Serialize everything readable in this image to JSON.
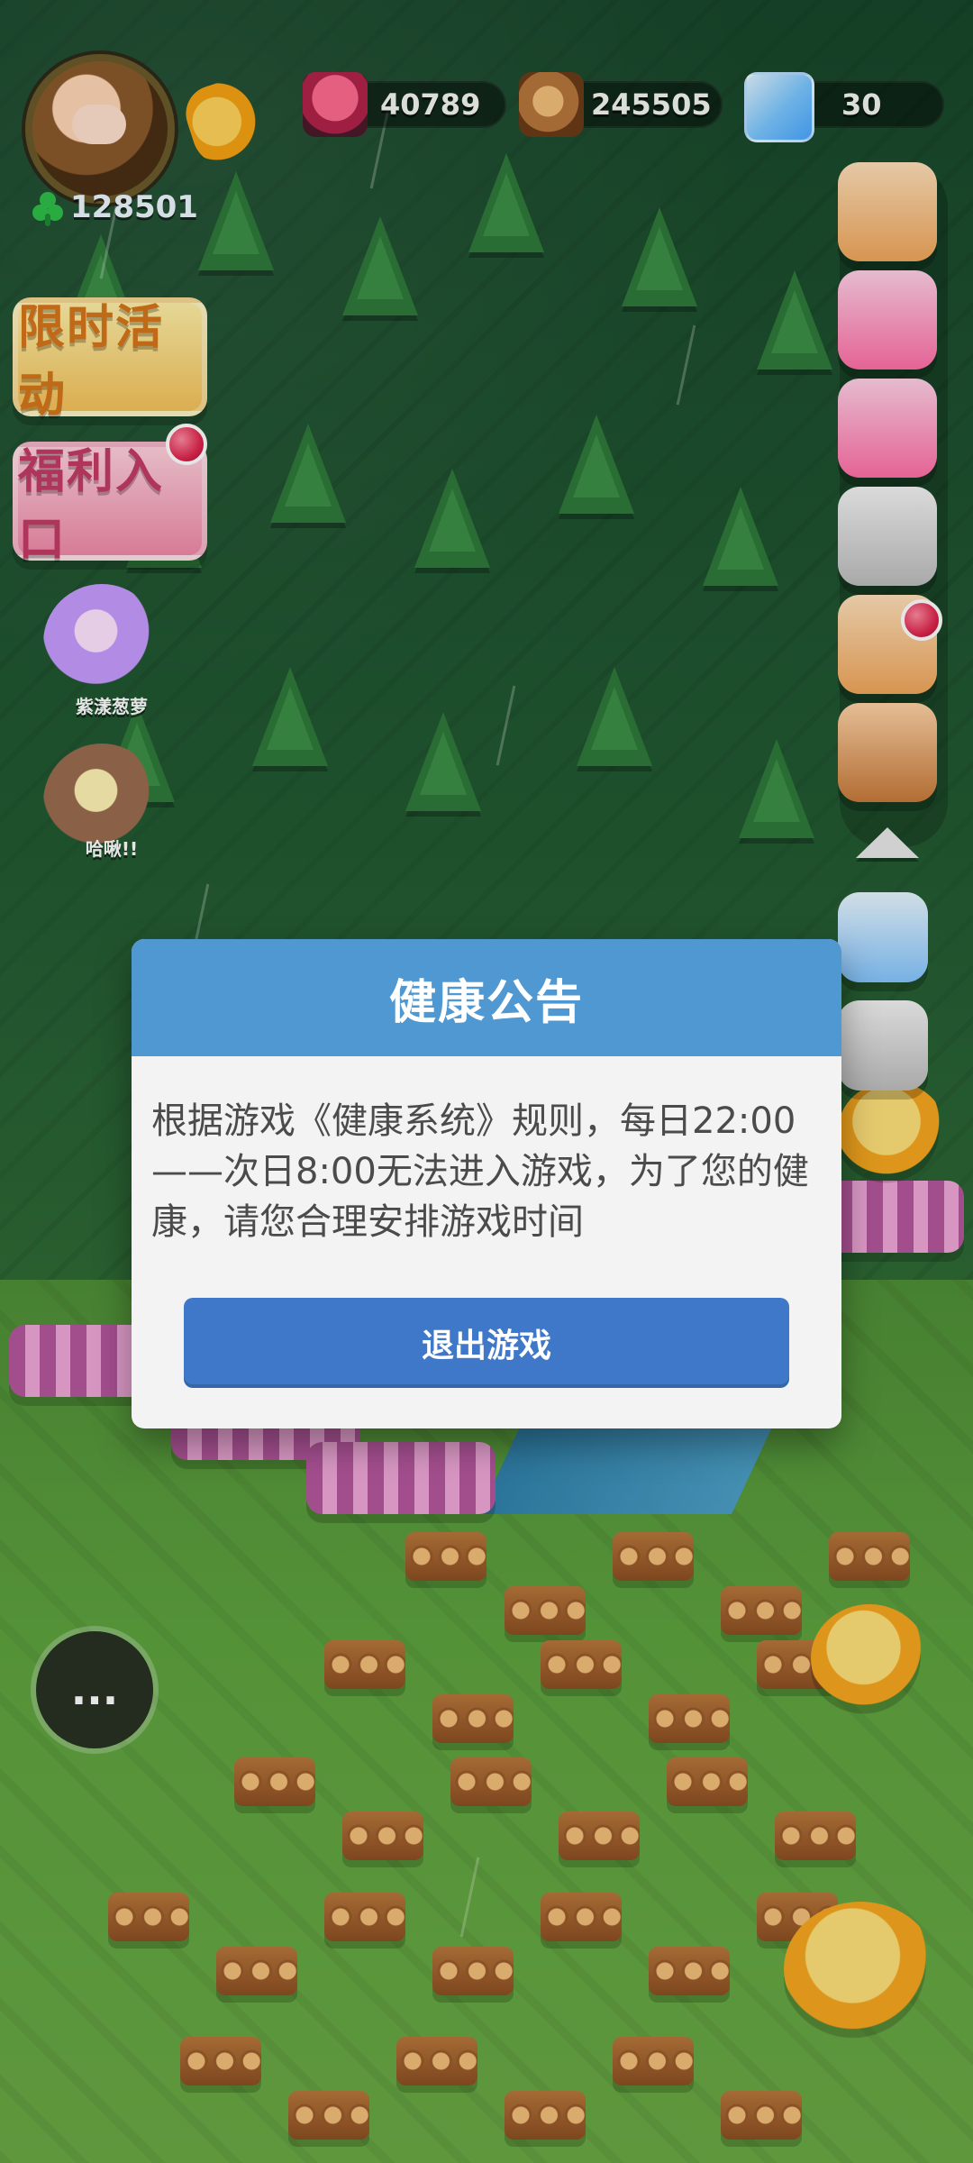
{
  "hud": {
    "clover_count": "128501",
    "resources": [
      {
        "icon": "potion-jar-icon",
        "value": "40789"
      },
      {
        "icon": "logs-icon",
        "value": "245505"
      },
      {
        "icon": "gem-icon",
        "value": "30"
      }
    ]
  },
  "left_menu": {
    "limited_event_label": "限时活动",
    "welfare_label": "福利入口",
    "characters": [
      {
        "name": "紫漾葱萝"
      },
      {
        "name": "哈啾!!"
      }
    ]
  },
  "dialog": {
    "title": "健康公告",
    "message": "根据游戏《健康系统》规则，每日22:00——次日8:00无法进入游戏，为了您的健康，请您合理安排游戏时间",
    "button_label": "退出游戏"
  },
  "chat": {
    "bubble_text": "..."
  }
}
